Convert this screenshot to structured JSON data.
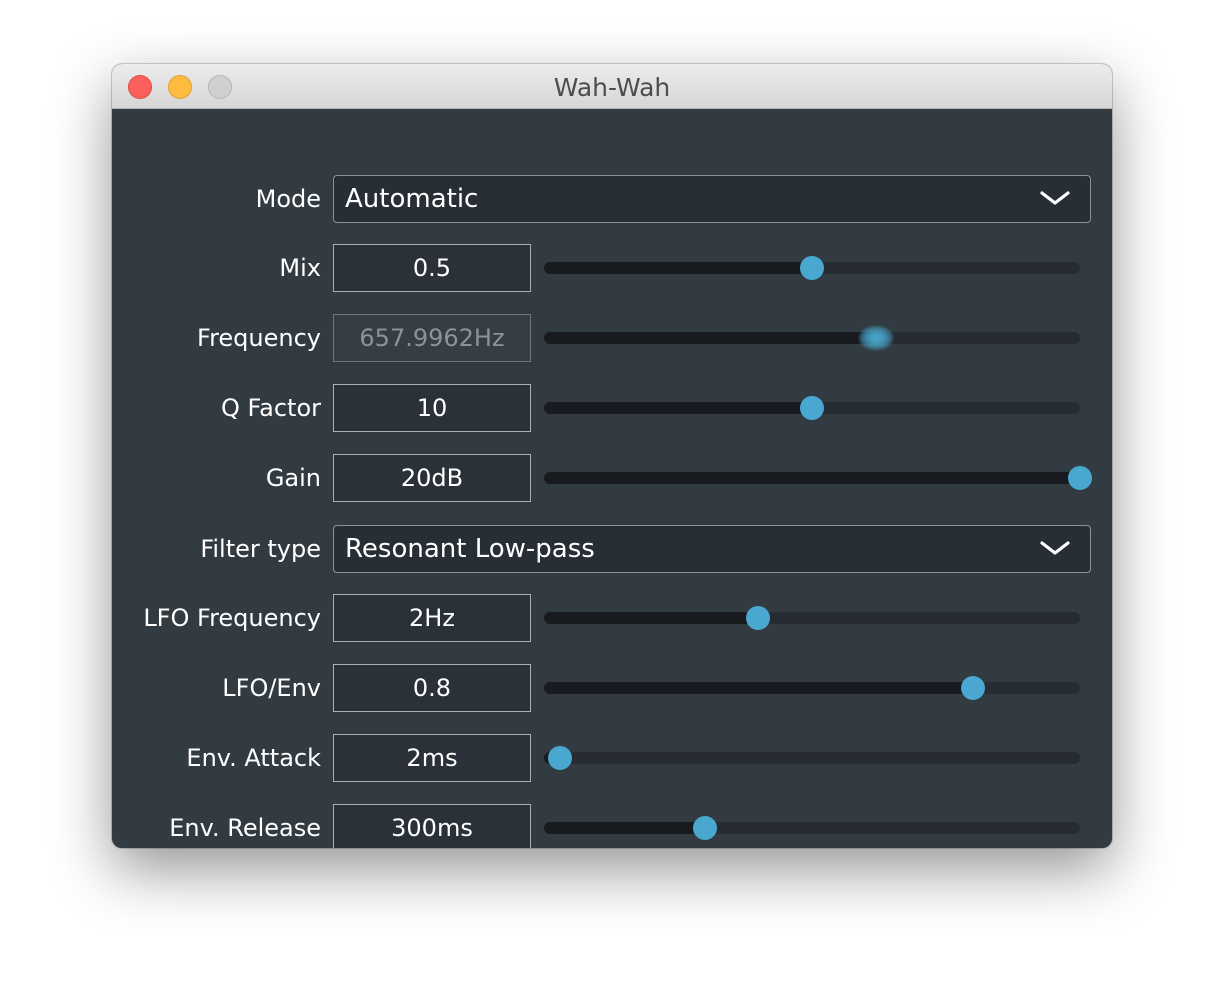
{
  "window": {
    "title": "Wah-Wah"
  },
  "controls": {
    "mode": {
      "label": "Mode",
      "value": "Automatic"
    },
    "mix": {
      "label": "Mix",
      "value": "0.5",
      "level": 0.5
    },
    "frequency": {
      "label": "Frequency",
      "value": "657.9962Hz",
      "level": 0.62,
      "disabled": true
    },
    "q_factor": {
      "label": "Q Factor",
      "value": "10",
      "level": 0.5
    },
    "gain": {
      "label": "Gain",
      "value": "20dB",
      "level": 1.0
    },
    "filter_type": {
      "label": "Filter type",
      "value": "Resonant Low-pass"
    },
    "lfo_frequency": {
      "label": "LFO Frequency",
      "value": "2Hz",
      "level": 0.4
    },
    "lfo_env": {
      "label": "LFO/Env",
      "value": "0.8",
      "level": 0.8
    },
    "env_attack": {
      "label": "Env. Attack",
      "value": "2ms",
      "level": 0.03
    },
    "env_release": {
      "label": "Env. Release",
      "value": "300ms",
      "level": 0.3
    }
  },
  "colors": {
    "panel_bg": "#333b42",
    "accent": "#4aa7cf",
    "text": "#ffffff"
  },
  "icons": {
    "dropdown": "chevron-down-icon"
  }
}
